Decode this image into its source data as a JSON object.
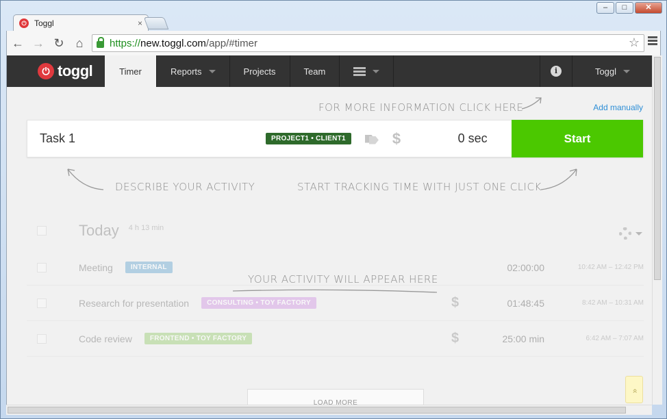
{
  "browser": {
    "tab_title": "Toggl",
    "tab_close": "×",
    "url_scheme": "https://",
    "url_host": "new.toggl.com",
    "url_path": "/app/#timer",
    "window_controls": [
      "minimize",
      "maximize",
      "close"
    ]
  },
  "app_nav": {
    "brand": "toggl",
    "items": [
      {
        "label": "Timer",
        "active": true
      },
      {
        "label": "Reports",
        "dropdown": true
      },
      {
        "label": "Projects"
      },
      {
        "label": "Team"
      }
    ],
    "user_label": "Toggl"
  },
  "hints": {
    "more_info": "FOR MORE INFORMATION CLICK HERE",
    "describe": "DESCRIBE YOUR ACTIVITY",
    "start_tracking": "START TRACKING TIME WITH JUST ONE CLICK",
    "activity_appear": "YOUR ACTIVITY WILL APPEAR HERE"
  },
  "add_manually": "Add manually",
  "timer": {
    "description": "Task 1",
    "project_label": "PROJECT1  •  CLIENT1",
    "billable_symbol": "$",
    "duration": "0 sec",
    "start_label": "Start"
  },
  "day": {
    "title": "Today",
    "total": "4 h 13 min"
  },
  "entries": [
    {
      "description": "Meeting",
      "label": "INTERNAL",
      "label_color": "#7fb4d6",
      "billable": "",
      "duration": "02:00:00",
      "range": "10:42 AM – 12:42 PM"
    },
    {
      "description": "Research for presentation",
      "label": "CONSULTING  •  TOY FACTORY",
      "label_color": "#d7a6e6",
      "billable": "$",
      "duration": "01:48:45",
      "range": "8:42 AM – 10:31 AM"
    },
    {
      "description": "Code review",
      "label": "FRONTEND  •  TOY FACTORY",
      "label_color": "#a8d387",
      "billable": "$",
      "duration": "25:00 min",
      "range": "6:42 AM – 7:07 AM"
    }
  ],
  "load_more": "LOAD MORE",
  "scroll_top_symbol": "»",
  "colors": {
    "nav_bg": "#333333",
    "start_green": "#4bc800",
    "project_green": "#2e6a2b",
    "link_blue": "#2d8ed6",
    "brand_red": "#e0393e"
  }
}
